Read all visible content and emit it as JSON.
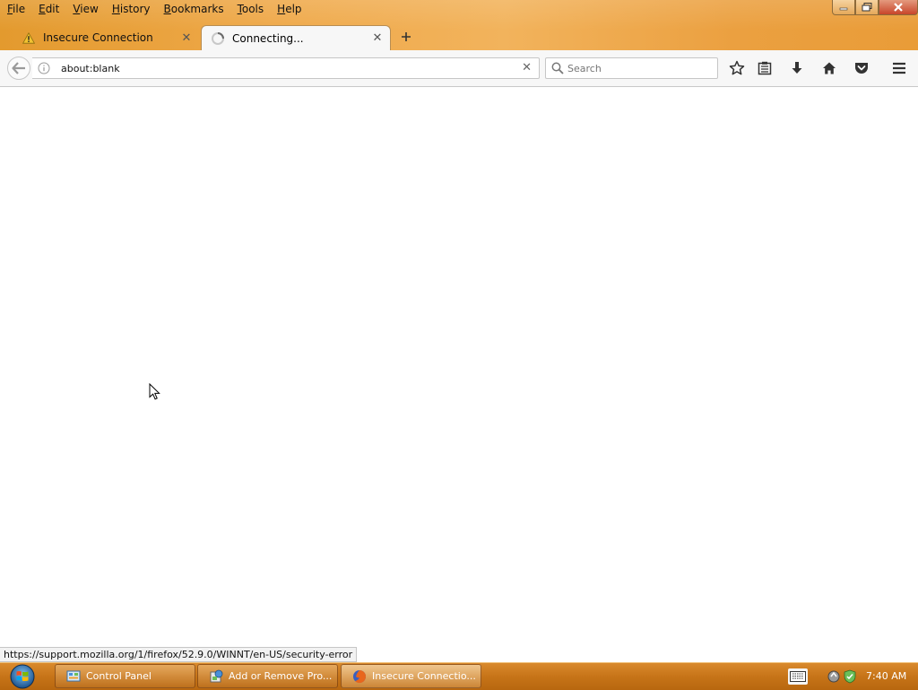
{
  "menu": {
    "items": [
      "File",
      "Edit",
      "View",
      "History",
      "Bookmarks",
      "Tools",
      "Help"
    ]
  },
  "window_controls": {
    "minimize_icon": "minimize-icon",
    "maximize_icon": "restore-icon",
    "close_icon": "close-icon"
  },
  "tabs": [
    {
      "title": "Insecure Connection",
      "icon": "warning-icon",
      "active": false
    },
    {
      "title": "Connecting...",
      "icon": "loading-spinner-icon",
      "active": true
    }
  ],
  "toolbar": {
    "url": "about:blank",
    "search_placeholder": "Search",
    "icons": [
      "back-arrow-icon",
      "info-icon",
      "clear-icon",
      "search-icon",
      "bookmark-star-icon",
      "reading-list-icon",
      "downloads-icon",
      "home-icon",
      "pocket-icon",
      "menu-icon"
    ]
  },
  "status": {
    "link": "https://support.mozilla.org/1/firefox/52.9.0/WINNT/en-US/security-error"
  },
  "taskbar": {
    "items": [
      {
        "label": "Control Panel",
        "icon": "control-panel-icon",
        "active": false
      },
      {
        "label": "Add or Remove Pro...",
        "icon": "programs-icon",
        "active": false
      },
      {
        "label": "Insecure Connectio...",
        "icon": "firefox-icon",
        "active": true
      }
    ],
    "clock": "7:40 AM",
    "tray_icons": [
      "keyboard-icon",
      "network-icon",
      "security-center-icon"
    ]
  },
  "colors": {
    "window_frame": "#eba040",
    "taskbar": "#c77418",
    "toolbar_bg": "#f7f7f7",
    "warning": "#f1c232"
  }
}
